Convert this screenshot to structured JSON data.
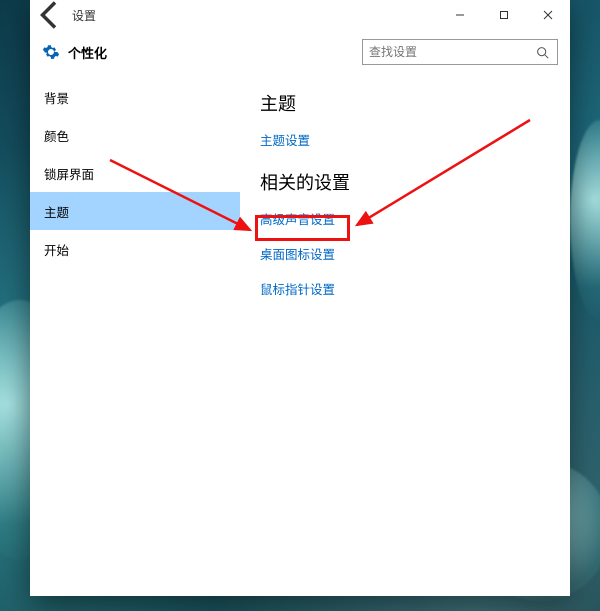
{
  "titlebar": {
    "title": "设置"
  },
  "header": {
    "title": "个性化"
  },
  "search": {
    "placeholder": "查找设置"
  },
  "sidebar": {
    "items": [
      {
        "label": "背景"
      },
      {
        "label": "颜色"
      },
      {
        "label": "锁屏界面"
      },
      {
        "label": "主题"
      },
      {
        "label": "开始"
      }
    ],
    "selected_index": 3
  },
  "content": {
    "section1_title": "主题",
    "link1": "主题设置",
    "section2_title": "相关的设置",
    "link2": "高级声音设置",
    "link3": "桌面图标设置",
    "link4": "鼠标指针设置"
  }
}
